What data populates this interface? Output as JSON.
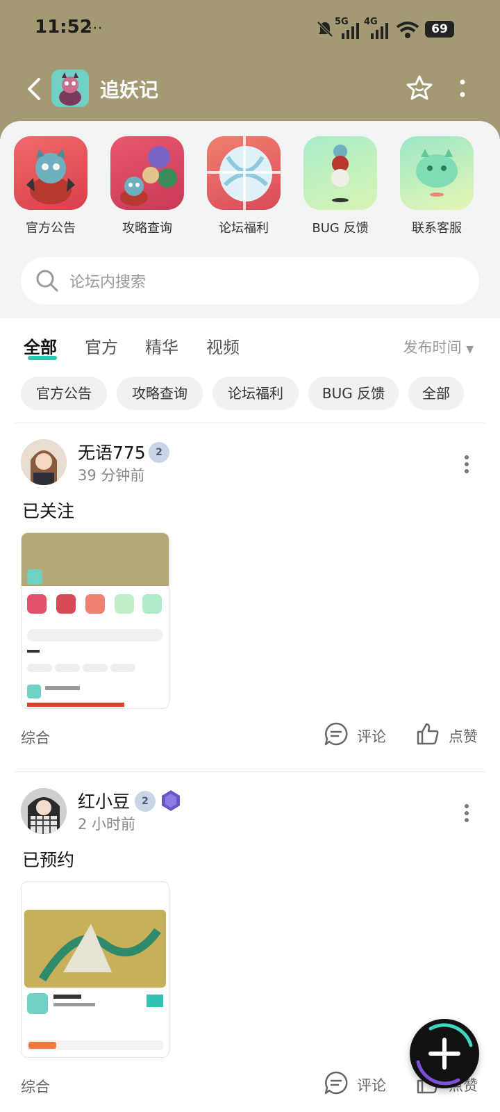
{
  "status_bar": {
    "time": "11:52",
    "battery": "69",
    "net1": "5G",
    "net2": "4G"
  },
  "header": {
    "title": "追妖记"
  },
  "shortcuts": [
    {
      "label": "官方公告"
    },
    {
      "label": "攻略查询"
    },
    {
      "label": "论坛福利"
    },
    {
      "label": "BUG 反馈"
    },
    {
      "label": "联系客服"
    }
  ],
  "search": {
    "placeholder": "论坛内搜索"
  },
  "tabs": [
    {
      "label": "全部",
      "active": true
    },
    {
      "label": "官方"
    },
    {
      "label": "精华"
    },
    {
      "label": "视频"
    }
  ],
  "sort": {
    "label": "发布时间"
  },
  "chips": [
    {
      "label": "官方公告"
    },
    {
      "label": "攻略查询"
    },
    {
      "label": "论坛福利"
    },
    {
      "label": "BUG 反馈"
    },
    {
      "label": "全部"
    }
  ],
  "posts": [
    {
      "user": "无语775",
      "time": "39 分钟前",
      "text": "已关注",
      "category": "综合",
      "comment": "评论",
      "like": "点赞",
      "badge": "2"
    },
    {
      "user": "红小豆",
      "time": "2 小时前",
      "text": "已预约",
      "category": "综合",
      "comment": "评论",
      "like": "点赞",
      "badge": "2"
    }
  ],
  "colors": {
    "accent": "#30c3b2",
    "header_bg": "#a39a74"
  }
}
